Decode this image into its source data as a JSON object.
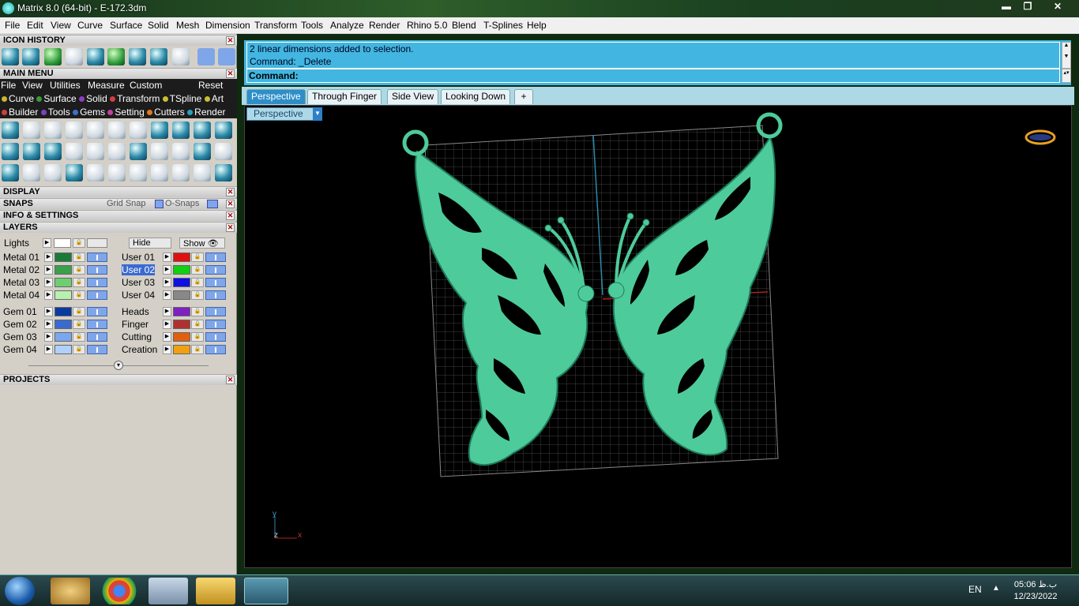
{
  "window": {
    "title": "Matrix 8.0 (64-bit) - E-172.3dm",
    "min": "▬",
    "restore": "❐",
    "close": "✕"
  },
  "menubar": [
    "File",
    "Edit",
    "View",
    "Curve",
    "Surface",
    "Solid",
    "Mesh",
    "Dimension",
    "Transform",
    "Tools",
    "Analyze",
    "Render",
    "Rhino 5.0",
    "Blend",
    "T-Splines",
    "Help"
  ],
  "panel": {
    "icon_history": "ICON HISTORY",
    "main_menu": "MAIN MENU",
    "main_menu_items": [
      "File",
      "View",
      "Utilities",
      "Measure",
      "Custom"
    ],
    "reset": "Reset",
    "row1": [
      "Curve",
      "Surface",
      "Solid",
      "Transform",
      "TSpline",
      "Art"
    ],
    "row1_colors": [
      "#c8b830",
      "#3a9a3a",
      "#8a40c0",
      "#d04040",
      "#c8c030",
      "#c8c030"
    ],
    "row2": [
      "Builder",
      "Tools",
      "Gems",
      "Setting",
      "Cutters",
      "Render"
    ],
    "row2_colors": [
      "#d04040",
      "#8040c0",
      "#3a70d0",
      "#c040a0",
      "#e07a20",
      "#2aa0c0"
    ],
    "display": "DISPLAY",
    "snaps": "SNAPS",
    "grid_snap": "Grid Snap",
    "osnaps": "O-Snaps",
    "info": "INFO & SETTINGS",
    "layers": "LAYERS",
    "lights": "Lights",
    "hide": "Hide",
    "show": "Show",
    "projects": "PROJECTS"
  },
  "layers_left": [
    {
      "name": "Metal 01",
      "color": "#1a7a3a"
    },
    {
      "name": "Metal 02",
      "color": "#3aa04a"
    },
    {
      "name": "Metal 03",
      "color": "#6cd070"
    },
    {
      "name": "Metal 04",
      "color": "#b8f0b0"
    },
    {
      "name": "Gem 01",
      "color": "#0a3aa0"
    },
    {
      "name": "Gem 02",
      "color": "#3a6ad0"
    },
    {
      "name": "Gem 03",
      "color": "#7aa8f0"
    },
    {
      "name": "Gem 04",
      "color": "#b0d0ff"
    }
  ],
  "layers_right": [
    {
      "name": "User 01",
      "color": "#e01010"
    },
    {
      "name": "User 02",
      "color": "#10d010",
      "selected": true
    },
    {
      "name": "User 03",
      "color": "#1010e0"
    },
    {
      "name": "User 04",
      "color": "#888888"
    },
    {
      "name": "Heads",
      "color": "#8020c0"
    },
    {
      "name": "Finger",
      "color": "#b03030"
    },
    {
      "name": "Cutting",
      "color": "#e06010"
    },
    {
      "name": "Creation",
      "color": "#f0a010"
    }
  ],
  "command": {
    "history1": "2 linear dimensions added to selection.",
    "history2": "Command: _Delete",
    "prompt": "Command:"
  },
  "tabs": [
    "Perspective",
    "Through Finger",
    "Side View",
    "Looking Down"
  ],
  "add_tab": "+",
  "viewport": {
    "label": "Perspective",
    "axis_y": "y",
    "axis_z": "z",
    "axis_x": "x"
  },
  "taskbar": {
    "lang": "EN",
    "time": "05:06 ب.ظ",
    "date": "12/23/2022"
  }
}
